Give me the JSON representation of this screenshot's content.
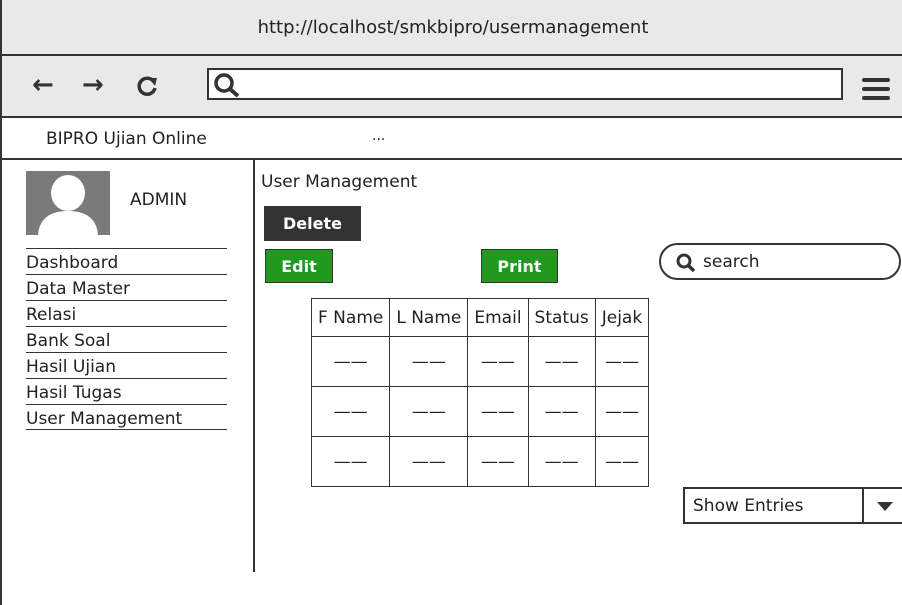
{
  "browser": {
    "url": "http://localhost/smkbipro/usermanagement",
    "back_icon": "←",
    "forward_icon": "→",
    "reload_icon": "C",
    "search_value": ""
  },
  "tab": {
    "title": "BIPRO Ujian Online",
    "more": "..."
  },
  "sidebar": {
    "user_label": "ADMIN",
    "items": [
      {
        "label": "Dashboard"
      },
      {
        "label": "Data Master"
      },
      {
        "label": "Relasi"
      },
      {
        "label": "Bank Soal"
      },
      {
        "label": "Hasil Ujian"
      },
      {
        "label": "Hasil Tugas"
      },
      {
        "label": "User Management"
      }
    ]
  },
  "main": {
    "title": "User Management",
    "delete_label": "Delete",
    "edit_label": "Edit",
    "print_label": "Print",
    "search_placeholder": "search",
    "table": {
      "headers": [
        "F Name",
        "L Name",
        "Email",
        "Status",
        "Jejak"
      ],
      "rows": [
        [
          "——",
          "——",
          "——",
          "——",
          "——"
        ],
        [
          "——",
          "——",
          "——",
          "——",
          "——"
        ],
        [
          "——",
          "——",
          "——",
          "——",
          "——"
        ]
      ]
    },
    "entries_label": "Show Entries"
  },
  "colors": {
    "chrome_bg": "#e9e9e9",
    "delete_bg": "#333333",
    "action_green": "#1f9a1f"
  }
}
